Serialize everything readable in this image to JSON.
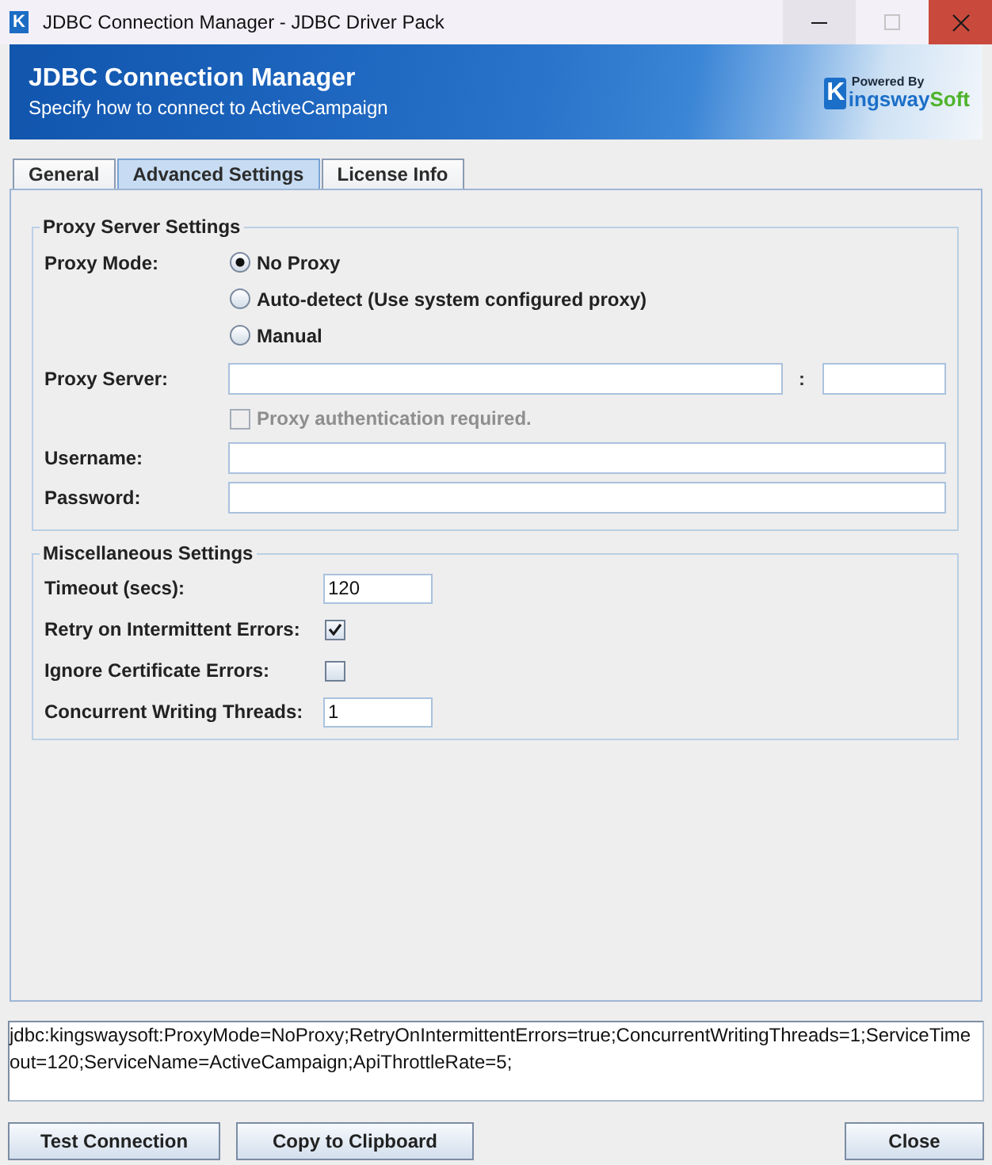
{
  "window": {
    "icon_letter": "K",
    "title": "JDBC Connection Manager - JDBC Driver Pack",
    "controls": [
      {
        "kind": "minimize",
        "disabled": false
      },
      {
        "kind": "maximize",
        "disabled": true
      },
      {
        "kind": "close",
        "disabled": false
      }
    ]
  },
  "banner": {
    "title": "JDBC Connection Manager",
    "subtitle": "Specify how to connect to ActiveCampaign",
    "logo": {
      "tagline": "Powered By",
      "initial": "K",
      "name": "ingsway",
      "suffix": "Soft"
    }
  },
  "tabs": [
    {
      "label": "General",
      "selected": false
    },
    {
      "label": "Advanced Settings",
      "selected": true
    },
    {
      "label": "License Info",
      "selected": false
    }
  ],
  "proxy_settings": {
    "title": "Proxy Server Settings",
    "proxy_mode": {
      "label": "Proxy Mode:",
      "options": [
        {
          "label": "No Proxy",
          "selected": true
        },
        {
          "label": "Auto-detect (Use system configured proxy)",
          "selected": false
        },
        {
          "label": "Manual",
          "selected": false
        }
      ]
    },
    "proxy_server": {
      "label": "Proxy Server:",
      "separator": ":"
    },
    "authentication": {
      "label": "Proxy authentication required.",
      "checked": false,
      "disabled": true
    },
    "username": {
      "label": "Username:"
    },
    "password": {
      "label": "Password:"
    }
  },
  "misc_settings": {
    "title": "Miscellaneous Settings",
    "rows": [
      {
        "kind": "field",
        "label": "Timeout (secs):",
        "value": "120"
      },
      {
        "kind": "checkbox",
        "label": "Retry on Intermittent Errors:",
        "checked": true
      },
      {
        "kind": "checkbox",
        "label": "Ignore Certificate Errors:",
        "checked": false
      },
      {
        "kind": "field",
        "label": "Concurrent Writing Threads:",
        "value": "1"
      }
    ]
  },
  "connection_string": "jdbc:kingswaysoft:ProxyMode=NoProxy;RetryOnIntermittentErrors=true;ConcurrentWritingThreads=1;ServiceTimeout=120;ServiceName=ActiveCampaign;ApiThrottleRate=5;",
  "buttons": [
    {
      "label": "Test Connection",
      "kind": "left"
    },
    {
      "label": "Copy to Clipboard",
      "kind": "left"
    },
    {
      "label": "Close",
      "kind": "right"
    }
  ]
}
